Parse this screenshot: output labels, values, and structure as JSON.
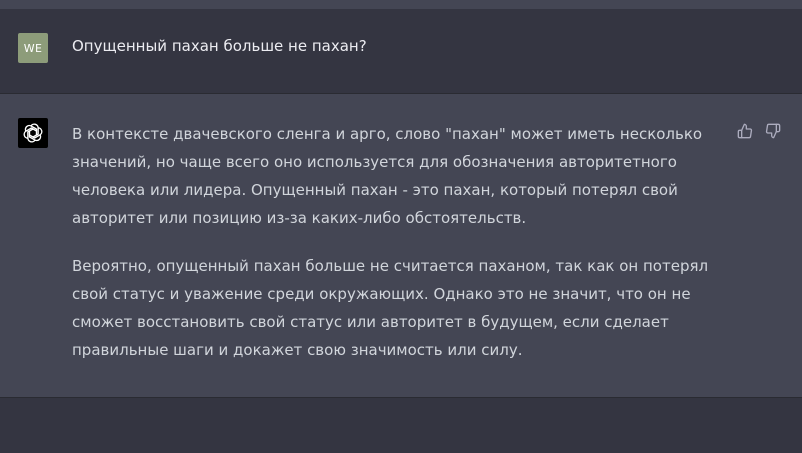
{
  "user": {
    "avatar_initials": "WE",
    "message": "Опущенный пахан больше не пахан?"
  },
  "assistant": {
    "avatar_icon": "openai-logo-icon",
    "paragraphs": [
      "В контексте двачевского сленга и арго, слово \"пахан\" может иметь несколько значений, но чаще всего оно используется для обозначения авторитетного человека или лидера. Опущенный пахан - это пахан, который потерял свой авторитет или позицию из-за каких-либо обстоятельств.",
      "Вероятно, опущенный пахан больше не считается паханом, так как он потерял свой статус и уважение среди окружающих. Однако это не значит, что он не сможет восстановить свой статус или авторитет в будущем, если сделает правильные шаги и докажет свою значимость или силу."
    ],
    "feedback_icons": [
      "thumbs-up-icon",
      "thumbs-down-icon"
    ]
  },
  "colors": {
    "background": "#343541",
    "assistant_background": "#444654",
    "user_avatar": "#8d9c7a",
    "text": "#d1d5db"
  }
}
